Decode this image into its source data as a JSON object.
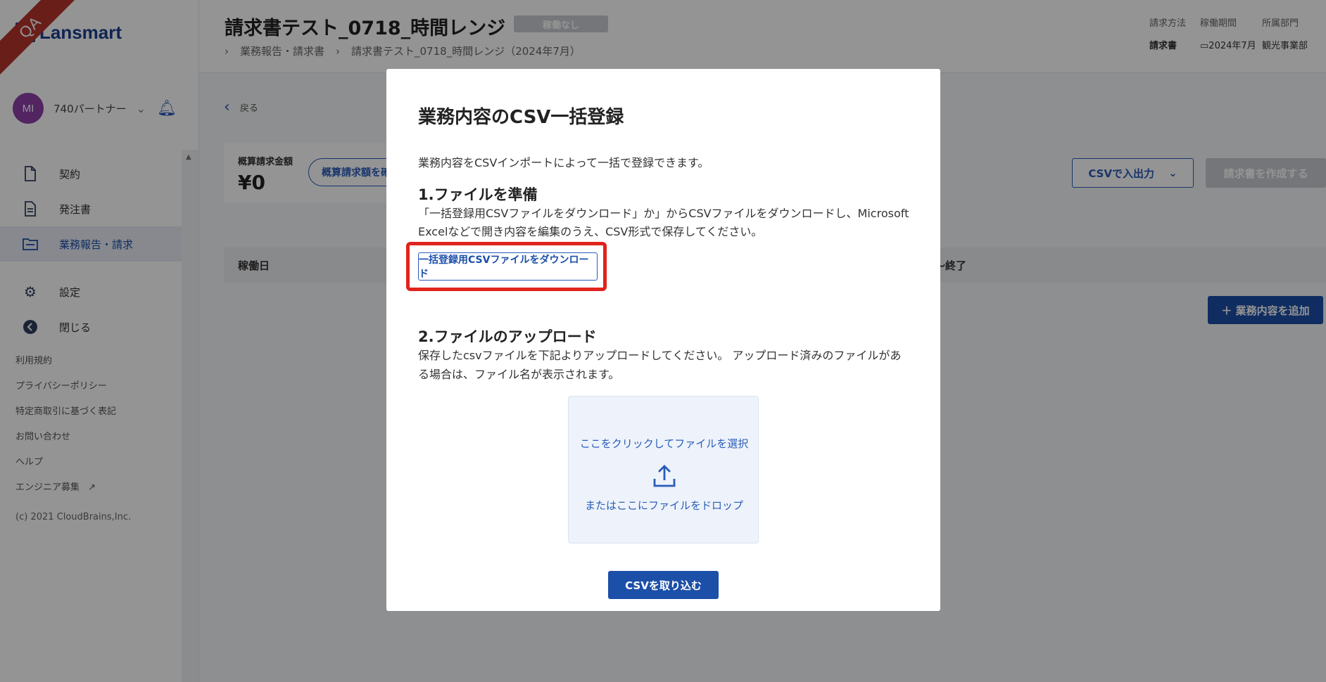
{
  "app": {
    "logo_text": "Lansmart",
    "env_ribbon": "QA"
  },
  "user": {
    "initials": "MI",
    "name": "740パートナー"
  },
  "sidebar": {
    "items": [
      {
        "label": "契約",
        "icon": "document-icon"
      },
      {
        "label": "発注書",
        "icon": "document-lines-icon"
      },
      {
        "label": "業務報告・請求",
        "icon": "folder-icon"
      },
      {
        "label": "設定",
        "icon": "gear-icon"
      },
      {
        "label": "閉じる",
        "icon": "arrow-left-circle-icon"
      }
    ],
    "links": [
      "利用規約",
      "プライバシーポリシー",
      "特定商取引に基づく表記",
      "お問い合わせ",
      "ヘルプ",
      "エンジニア募集"
    ],
    "copyright": "(c) 2021 CloudBrains,Inc."
  },
  "header": {
    "title": "請求書テスト_0718_時間レンジ",
    "status": "稼働なし",
    "breadcrumb": [
      "業務報告・請求書",
      "請求書テスト_0718_時間レンジ（2024年7月）"
    ],
    "meta": {
      "billing_method_label": "請求方法",
      "billing_method_value": "請求書",
      "period_label": "稼働期間",
      "period_value": "2024年7月",
      "department_label": "所属部門",
      "department_value": "観光事業部"
    }
  },
  "main": {
    "back_label": "戻る",
    "summary_label": "概算請求金額",
    "summary_value": "¥0",
    "summary_button": "概算請求額を確",
    "csv_io_label": "CSVで入出力",
    "create_invoice_label": "請求書を作成する",
    "table_headers": [
      "稼働日",
      "～終了"
    ],
    "add_task_label": "＋ 業務内容を追加"
  },
  "modal": {
    "title": "業務内容のCSV一括登録",
    "intro": "業務内容をCSVインポートによって一括で登録できます。",
    "step1_title": "1.ファイルを準備",
    "step1_desc": "「一括登録用CSVファイルをダウンロード」か」からCSVファイルをダウンロードし、Microsoft Excelなどで開き内容を編集のうえ、CSV形式で保存してください。",
    "download_button": "一括登録用CSVファイルをダウンロード",
    "step2_title": "2.ファイルのアップロード",
    "step2_desc": "保存したcsvファイルを下記よりアップロードしてください。 アップロード済みのファイルがある場合は、ファイル名が表示されます。",
    "dropzone_top": "ここをクリックしてファイルを選択",
    "dropzone_bottom": "またはここにファイルをドロップ",
    "import_button": "CSVを取り込む"
  },
  "colors": {
    "primary": "#1c4fa8",
    "highlight": "#e0241b",
    "ribbon": "#b5352c"
  }
}
